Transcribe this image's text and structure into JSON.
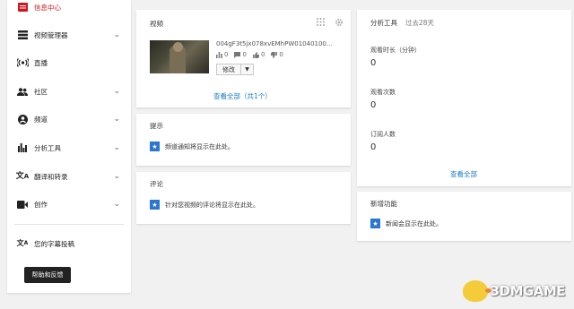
{
  "sidebar": {
    "items": [
      {
        "label": "信息中心",
        "icon": "dashboard-icon",
        "active": true
      },
      {
        "label": "视频管理器",
        "icon": "video-manager-icon"
      },
      {
        "label": "直播",
        "icon": "live-broadcast-icon"
      },
      {
        "label": "社区",
        "icon": "community-icon"
      },
      {
        "label": "频道",
        "icon": "channel-icon"
      },
      {
        "label": "分析工具",
        "icon": "analytics-icon"
      },
      {
        "label": "翻译和转录",
        "icon": "translate-icon"
      },
      {
        "label": "创作",
        "icon": "create-icon"
      },
      {
        "label": "您的字幕投稿",
        "icon": "subtitles-icon"
      }
    ],
    "help_button": "帮助和反馈"
  },
  "videos_card": {
    "title": "视频",
    "video_name": "004gF3t5jx078xvEMhPW01040100...",
    "stats": {
      "views": "0",
      "comments": "0",
      "likes": "0",
      "dislikes": "0"
    },
    "edit_label": "修改",
    "see_all": "查看全部（共1个）"
  },
  "tips_card": {
    "title": "提示",
    "message": "频道通知将显示在此处。"
  },
  "comments_card": {
    "title": "评论",
    "message": "针对您视频的评论将显示在此处。"
  },
  "analytics_card": {
    "title": "分析工具",
    "period": "过去28天",
    "metrics": [
      {
        "label": "观看时长（分钟）",
        "value": "0"
      },
      {
        "label": "观看次数",
        "value": "0"
      },
      {
        "label": "订阅人数",
        "value": "0"
      }
    ],
    "see_all": "查看全部"
  },
  "whats_new_card": {
    "title": "新增功能",
    "message": "新闻会显示在此处。"
  },
  "watermark": {
    "text": "3DMGAME"
  },
  "colors": {
    "accent": "#cc181e",
    "link": "#167ac6",
    "star": "#2b77cf"
  }
}
